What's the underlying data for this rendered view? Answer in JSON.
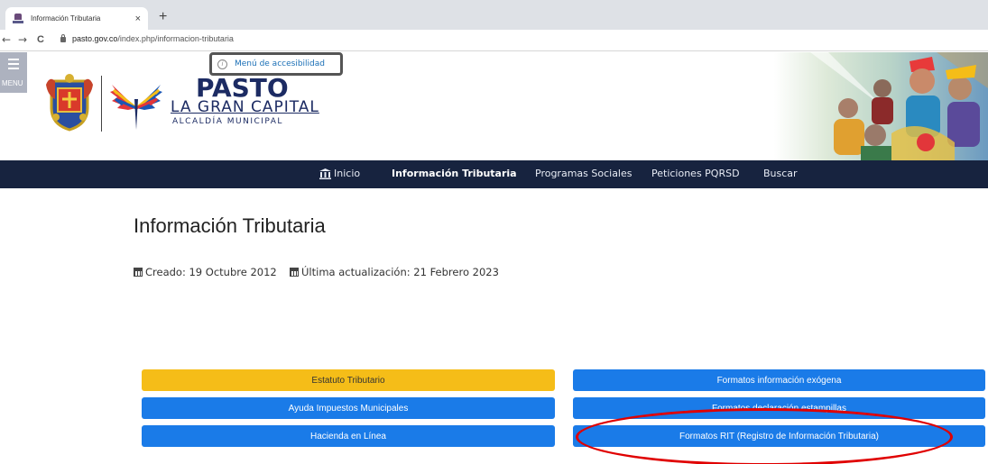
{
  "browser": {
    "tab_title": "Información Tributaria",
    "tab_close": "×",
    "new_tab": "+",
    "back": "←",
    "forward": "→",
    "reload": "C",
    "url_domain": "pasto.gov.co",
    "url_path": "/index.php/informacion-tributaria"
  },
  "header": {
    "menu_label": "MENU",
    "accessibility_label": "Menú de accesibilidad",
    "logo_line1": "PASTO",
    "logo_line2": "LA GRAN CAPITAL",
    "logo_line3": "ALCALDÍA MUNICIPAL"
  },
  "nav": {
    "items": [
      {
        "label": "Inicio"
      },
      {
        "label": "Información Tributaria"
      },
      {
        "label": "Programas Sociales"
      },
      {
        "label": "Peticiones PQRSD"
      },
      {
        "label": "Buscar"
      }
    ]
  },
  "article": {
    "title": "Información Tributaria",
    "created": "Creado: 19 Octubre 2012",
    "updated": "Última actualización: 21 Febrero 2023"
  },
  "buttons": {
    "left": [
      {
        "label": "Estatuto Tributario",
        "color": "#f5bd18"
      },
      {
        "label": "Ayuda Impuestos Municipales",
        "color": "#1a7be8"
      },
      {
        "label": "Hacienda en Línea",
        "color": "#1a7be8"
      }
    ],
    "right": [
      {
        "label": "Formatos información exógena",
        "color": "#1a7be8"
      },
      {
        "label": "Formatos declaración estampillas",
        "color": "#1a7be8"
      },
      {
        "label": "Formatos RIT (Registro de Información Tributaria)",
        "color": "#1a7be8"
      }
    ]
  },
  "annotation_color": "#e00000"
}
